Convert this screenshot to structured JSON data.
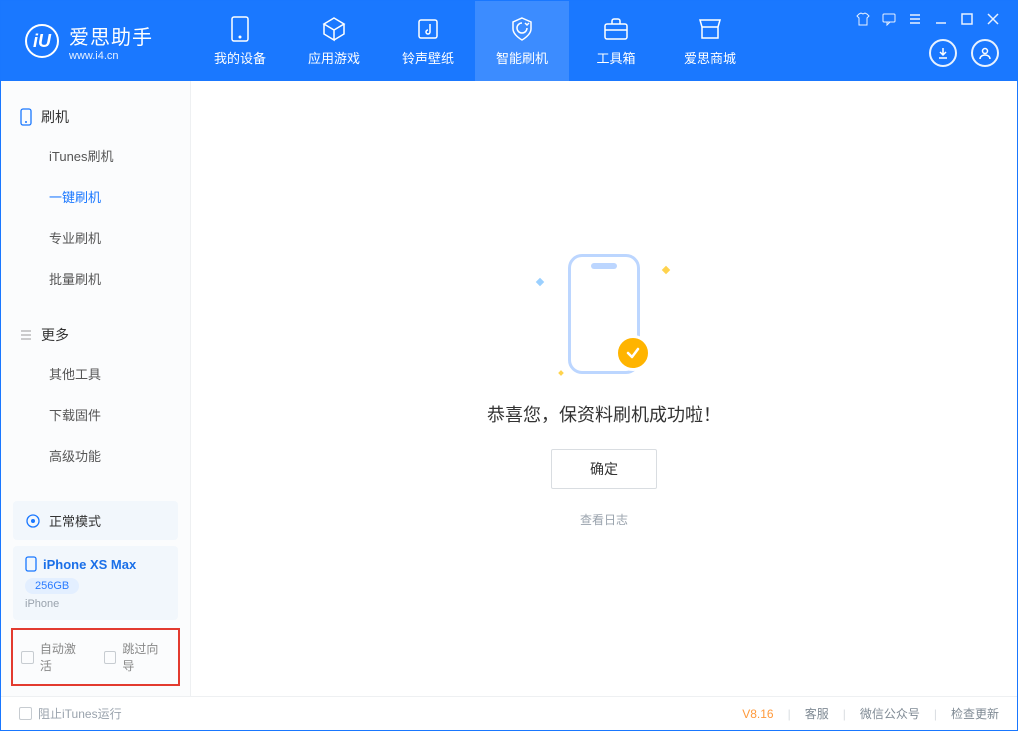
{
  "app": {
    "name": "爱思助手",
    "domain": "www.i4.cn",
    "logo_letter": "iU"
  },
  "nav": {
    "tabs": [
      {
        "label": "我的设备",
        "icon": "device"
      },
      {
        "label": "应用游戏",
        "icon": "cube"
      },
      {
        "label": "铃声壁纸",
        "icon": "music"
      },
      {
        "label": "智能刷机",
        "icon": "shield",
        "active": true
      },
      {
        "label": "工具箱",
        "icon": "toolbox"
      },
      {
        "label": "爱思商城",
        "icon": "store"
      }
    ]
  },
  "window_controls": {
    "tshirt": "tshirt",
    "feedback": "feedback",
    "menu": "menu",
    "min": "minimize",
    "max": "maximize",
    "close": "close"
  },
  "header_actions": {
    "download": "download-icon",
    "user": "user-icon"
  },
  "sidebar": {
    "groups": [
      {
        "title": "刷机",
        "icon": "phone-icon",
        "items": [
          {
            "label": "iTunes刷机"
          },
          {
            "label": "一键刷机",
            "active": true
          },
          {
            "label": "专业刷机"
          },
          {
            "label": "批量刷机"
          }
        ]
      },
      {
        "title": "更多",
        "icon": "list-icon",
        "items": [
          {
            "label": "其他工具"
          },
          {
            "label": "下载固件"
          },
          {
            "label": "高级功能"
          }
        ]
      }
    ],
    "mode": {
      "label": "正常模式",
      "icon": "sync-icon"
    },
    "device": {
      "name": "iPhone XS Max",
      "capacity": "256GB",
      "type": "iPhone",
      "icon": "phone-small-icon"
    },
    "options": {
      "auto_activate": "自动激活",
      "skip_guide": "跳过向导"
    }
  },
  "main": {
    "success_message": "恭喜您，保资料刷机成功啦！",
    "confirm_label": "确定",
    "view_log": "查看日志"
  },
  "footer": {
    "block_itunes": "阻止iTunes运行",
    "version": "V8.16",
    "links": {
      "support": "客服",
      "wechat": "微信公众号",
      "update": "检查更新"
    }
  }
}
